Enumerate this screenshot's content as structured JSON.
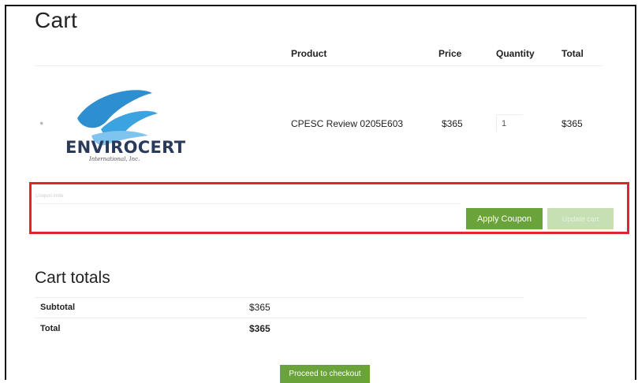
{
  "page": {
    "title": "Cart"
  },
  "cart_table": {
    "headers": {
      "product": "Product",
      "price": "Price",
      "quantity": "Quantity",
      "total": "Total"
    },
    "rows": [
      {
        "product": "CPESC Review 0205E603",
        "price": "$365",
        "quantity": "1",
        "total": "$365"
      }
    ]
  },
  "logo": {
    "brand": "ENVIROCERT",
    "sub": "International, Inc."
  },
  "coupon": {
    "placeholder": "Coupon code",
    "apply_label": "Apply Coupon",
    "update_label": "Update cart"
  },
  "totals": {
    "title": "Cart totals",
    "subtotal_label": "Subtotal",
    "subtotal_value": "$365",
    "total_label": "Total",
    "total_value": "$365"
  },
  "checkout": {
    "label": "Proceed to checkout"
  },
  "colors": {
    "accent": "#6aa33a",
    "highlight": "#e0262b",
    "logo_blue": "#2e8fd0"
  },
  "icons": {
    "remove": "remove-dot-icon"
  }
}
